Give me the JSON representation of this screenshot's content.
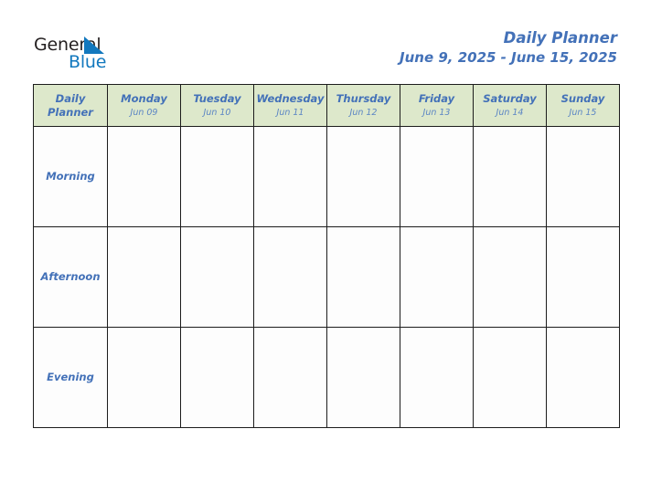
{
  "brand": {
    "name_dark": "General",
    "name_light": "Blue",
    "dark_color": "#231f20",
    "light_color": "#1278be",
    "triangle_color": "#1278be",
    "triangle_icon": "triangle-icon"
  },
  "header": {
    "title": "Daily Planner",
    "date_range": "June 9, 2025 - June 15, 2025",
    "accent_color": "#4371b8"
  },
  "table": {
    "corner": {
      "line1": "Daily",
      "line2": "Planner"
    },
    "header_bg": "#dde8cb",
    "row_label_bg": "#e9e9e9",
    "cell_bg": "#fdfdfd",
    "border_color": "#1c1c1c",
    "days": [
      {
        "name": "Monday",
        "date": "Jun 09"
      },
      {
        "name": "Tuesday",
        "date": "Jun 10"
      },
      {
        "name": "Wednesday",
        "date": "Jun 11"
      },
      {
        "name": "Thursday",
        "date": "Jun 12"
      },
      {
        "name": "Friday",
        "date": "Jun 13"
      },
      {
        "name": "Saturday",
        "date": "Jun 14"
      },
      {
        "name": "Sunday",
        "date": "Jun 15"
      }
    ],
    "periods": [
      {
        "label": "Morning",
        "entries": [
          "",
          "",
          "",
          "",
          "",
          "",
          ""
        ]
      },
      {
        "label": "Afternoon",
        "entries": [
          "",
          "",
          "",
          "",
          "",
          "",
          ""
        ]
      },
      {
        "label": "Evening",
        "entries": [
          "",
          "",
          "",
          "",
          "",
          "",
          ""
        ]
      }
    ]
  }
}
